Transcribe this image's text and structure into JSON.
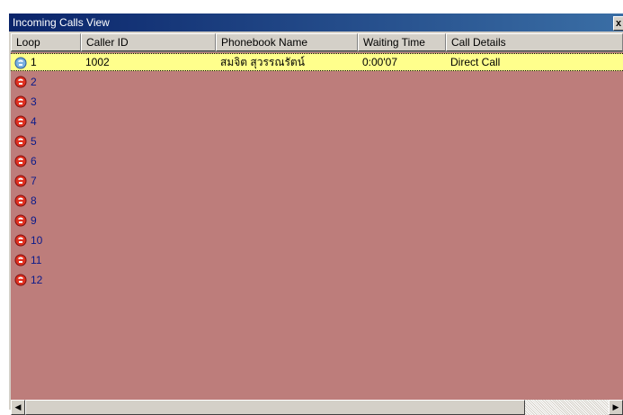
{
  "window": {
    "title": "Incoming Calls View",
    "close_glyph": "x"
  },
  "columns": [
    {
      "label": "Loop"
    },
    {
      "label": "Caller ID"
    },
    {
      "label": "Phonebook Name"
    },
    {
      "label": "Waiting Time"
    },
    {
      "label": "Call Details"
    }
  ],
  "rows": [
    {
      "loop": "1",
      "caller_id": "1002",
      "name": "สมจิต สุวรรณรัตน์",
      "waiting": "0:00'07",
      "details": "Direct Call",
      "icon": "phone-active-icon",
      "selected": true
    },
    {
      "loop": "2",
      "caller_id": "",
      "name": "",
      "waiting": "",
      "details": "",
      "icon": "phone-idle-icon"
    },
    {
      "loop": "3",
      "caller_id": "",
      "name": "",
      "waiting": "",
      "details": "",
      "icon": "phone-idle-icon"
    },
    {
      "loop": "4",
      "caller_id": "",
      "name": "",
      "waiting": "",
      "details": "",
      "icon": "phone-idle-icon"
    },
    {
      "loop": "5",
      "caller_id": "",
      "name": "",
      "waiting": "",
      "details": "",
      "icon": "phone-idle-icon"
    },
    {
      "loop": "6",
      "caller_id": "",
      "name": "",
      "waiting": "",
      "details": "",
      "icon": "phone-idle-icon"
    },
    {
      "loop": "7",
      "caller_id": "",
      "name": "",
      "waiting": "",
      "details": "",
      "icon": "phone-idle-icon"
    },
    {
      "loop": "8",
      "caller_id": "",
      "name": "",
      "waiting": "",
      "details": "",
      "icon": "phone-idle-icon"
    },
    {
      "loop": "9",
      "caller_id": "",
      "name": "",
      "waiting": "",
      "details": "",
      "icon": "phone-idle-icon"
    },
    {
      "loop": "10",
      "caller_id": "",
      "name": "",
      "waiting": "",
      "details": "",
      "icon": "phone-idle-icon"
    },
    {
      "loop": "11",
      "caller_id": "",
      "name": "",
      "waiting": "",
      "details": "",
      "icon": "phone-idle-icon"
    },
    {
      "loop": "12",
      "caller_id": "",
      "name": "",
      "waiting": "",
      "details": "",
      "icon": "phone-idle-icon"
    }
  ],
  "colors": {
    "list_background": "#bd7d7b",
    "selected_row": "#ffff8c",
    "loop_text": "#0a1a8a",
    "title_bar": "#0a246a"
  },
  "scrollbar": {
    "left_arrow": "◀",
    "right_arrow": "▶"
  }
}
